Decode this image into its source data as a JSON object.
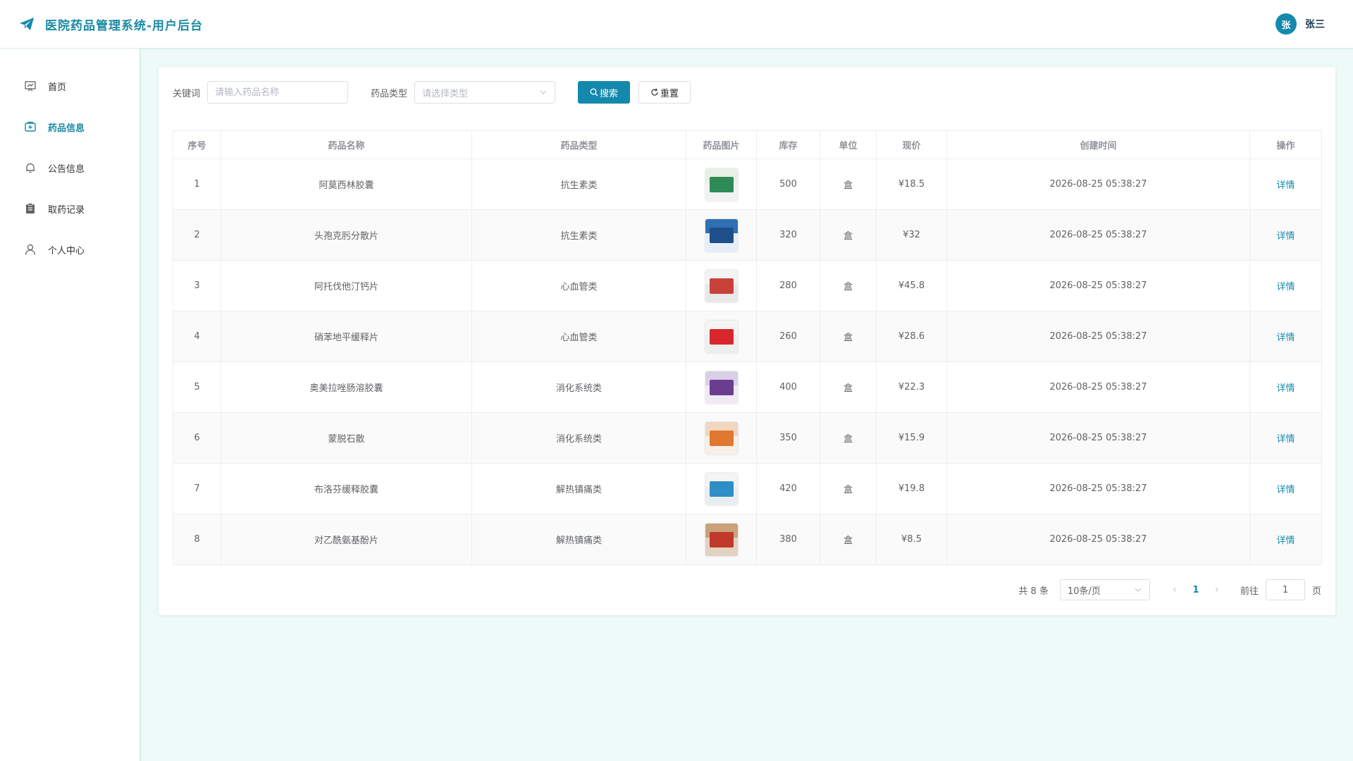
{
  "header": {
    "title": "医院药品管理系统-用户后台",
    "avatar_char": "张",
    "username": "张三"
  },
  "sidebar": {
    "items": [
      {
        "label": "首页",
        "icon": "dashboard-icon",
        "active": false
      },
      {
        "label": "药品信息",
        "icon": "medicine-box-icon",
        "active": true
      },
      {
        "label": "公告信息",
        "icon": "bell-icon",
        "active": false
      },
      {
        "label": "取药记录",
        "icon": "clipboard-icon",
        "active": false
      },
      {
        "label": "个人中心",
        "icon": "user-icon",
        "active": false
      }
    ]
  },
  "search": {
    "keyword_label": "关键词",
    "keyword_placeholder": "请输入药品名称",
    "type_label": "药品类型",
    "type_placeholder": "请选择类型",
    "search_button": "搜索",
    "reset_button": "重置"
  },
  "table": {
    "headers": [
      "序号",
      "药品名称",
      "药品类型",
      "药品图片",
      "库存",
      "单位",
      "现价",
      "创建时间",
      "操作"
    ],
    "rows": [
      {
        "no": "1",
        "name": "阿莫西林胶囊",
        "type": "抗生素类",
        "stock": "500",
        "unit": "盒",
        "price": "¥18.5",
        "created": "2026-08-25 05:38:27",
        "action": "详情",
        "thumb": [
          "#e8efe4",
          "#2e8b57",
          "#f2f2f2"
        ]
      },
      {
        "no": "2",
        "name": "头孢克肟分散片",
        "type": "抗生素类",
        "stock": "320",
        "unit": "盒",
        "price": "¥32",
        "created": "2026-08-25 05:38:27",
        "action": "详情",
        "thumb": [
          "#2f6fb3",
          "#1f4f8a",
          "#e6eef7"
        ]
      },
      {
        "no": "3",
        "name": "阿托伐他汀钙片",
        "type": "心血管类",
        "stock": "280",
        "unit": "盒",
        "price": "¥45.8",
        "created": "2026-08-25 05:38:27",
        "action": "详情",
        "thumb": [
          "#f3f3f3",
          "#c8423a",
          "#e8e8e8"
        ]
      },
      {
        "no": "4",
        "name": "硝苯地平缓释片",
        "type": "心血管类",
        "stock": "260",
        "unit": "盒",
        "price": "¥28.6",
        "created": "2026-08-25 05:38:27",
        "action": "详情",
        "thumb": [
          "#f5f5f5",
          "#d8262d",
          "#eeeeee"
        ]
      },
      {
        "no": "5",
        "name": "奥美拉唑肠溶胶囊",
        "type": "消化系统类",
        "stock": "400",
        "unit": "盒",
        "price": "¥22.3",
        "created": "2026-08-25 05:38:27",
        "action": "详情",
        "thumb": [
          "#d9cfe6",
          "#6a3d8f",
          "#efeaf4"
        ]
      },
      {
        "no": "6",
        "name": "蒙脱石散",
        "type": "消化系统类",
        "stock": "350",
        "unit": "盒",
        "price": "¥15.9",
        "created": "2026-08-25 05:38:27",
        "action": "详情",
        "thumb": [
          "#f2d6c0",
          "#e0782f",
          "#f6efe8"
        ]
      },
      {
        "no": "7",
        "name": "布洛芬缓释胶囊",
        "type": "解热镇痛类",
        "stock": "420",
        "unit": "盒",
        "price": "¥19.8",
        "created": "2026-08-25 05:38:27",
        "action": "详情",
        "thumb": [
          "#f4f4f4",
          "#2f8ec6",
          "#e9eef2"
        ]
      },
      {
        "no": "8",
        "name": "对乙酰氨基酚片",
        "type": "解热镇痛类",
        "stock": "380",
        "unit": "盒",
        "price": "¥8.5",
        "created": "2026-08-25 05:38:27",
        "action": "详情",
        "thumb": [
          "#c9a27a",
          "#c0392b",
          "#e3d2c0"
        ]
      }
    ]
  },
  "pagination": {
    "total_text": "共 8 条",
    "page_size": "10条/页",
    "prev": "‹",
    "current_page": "1",
    "next": "›",
    "goto_label": "前往",
    "goto_value": "1",
    "page_suffix": "页"
  },
  "colors": {
    "primary": "#1489ad",
    "background": "#eefaf8"
  }
}
